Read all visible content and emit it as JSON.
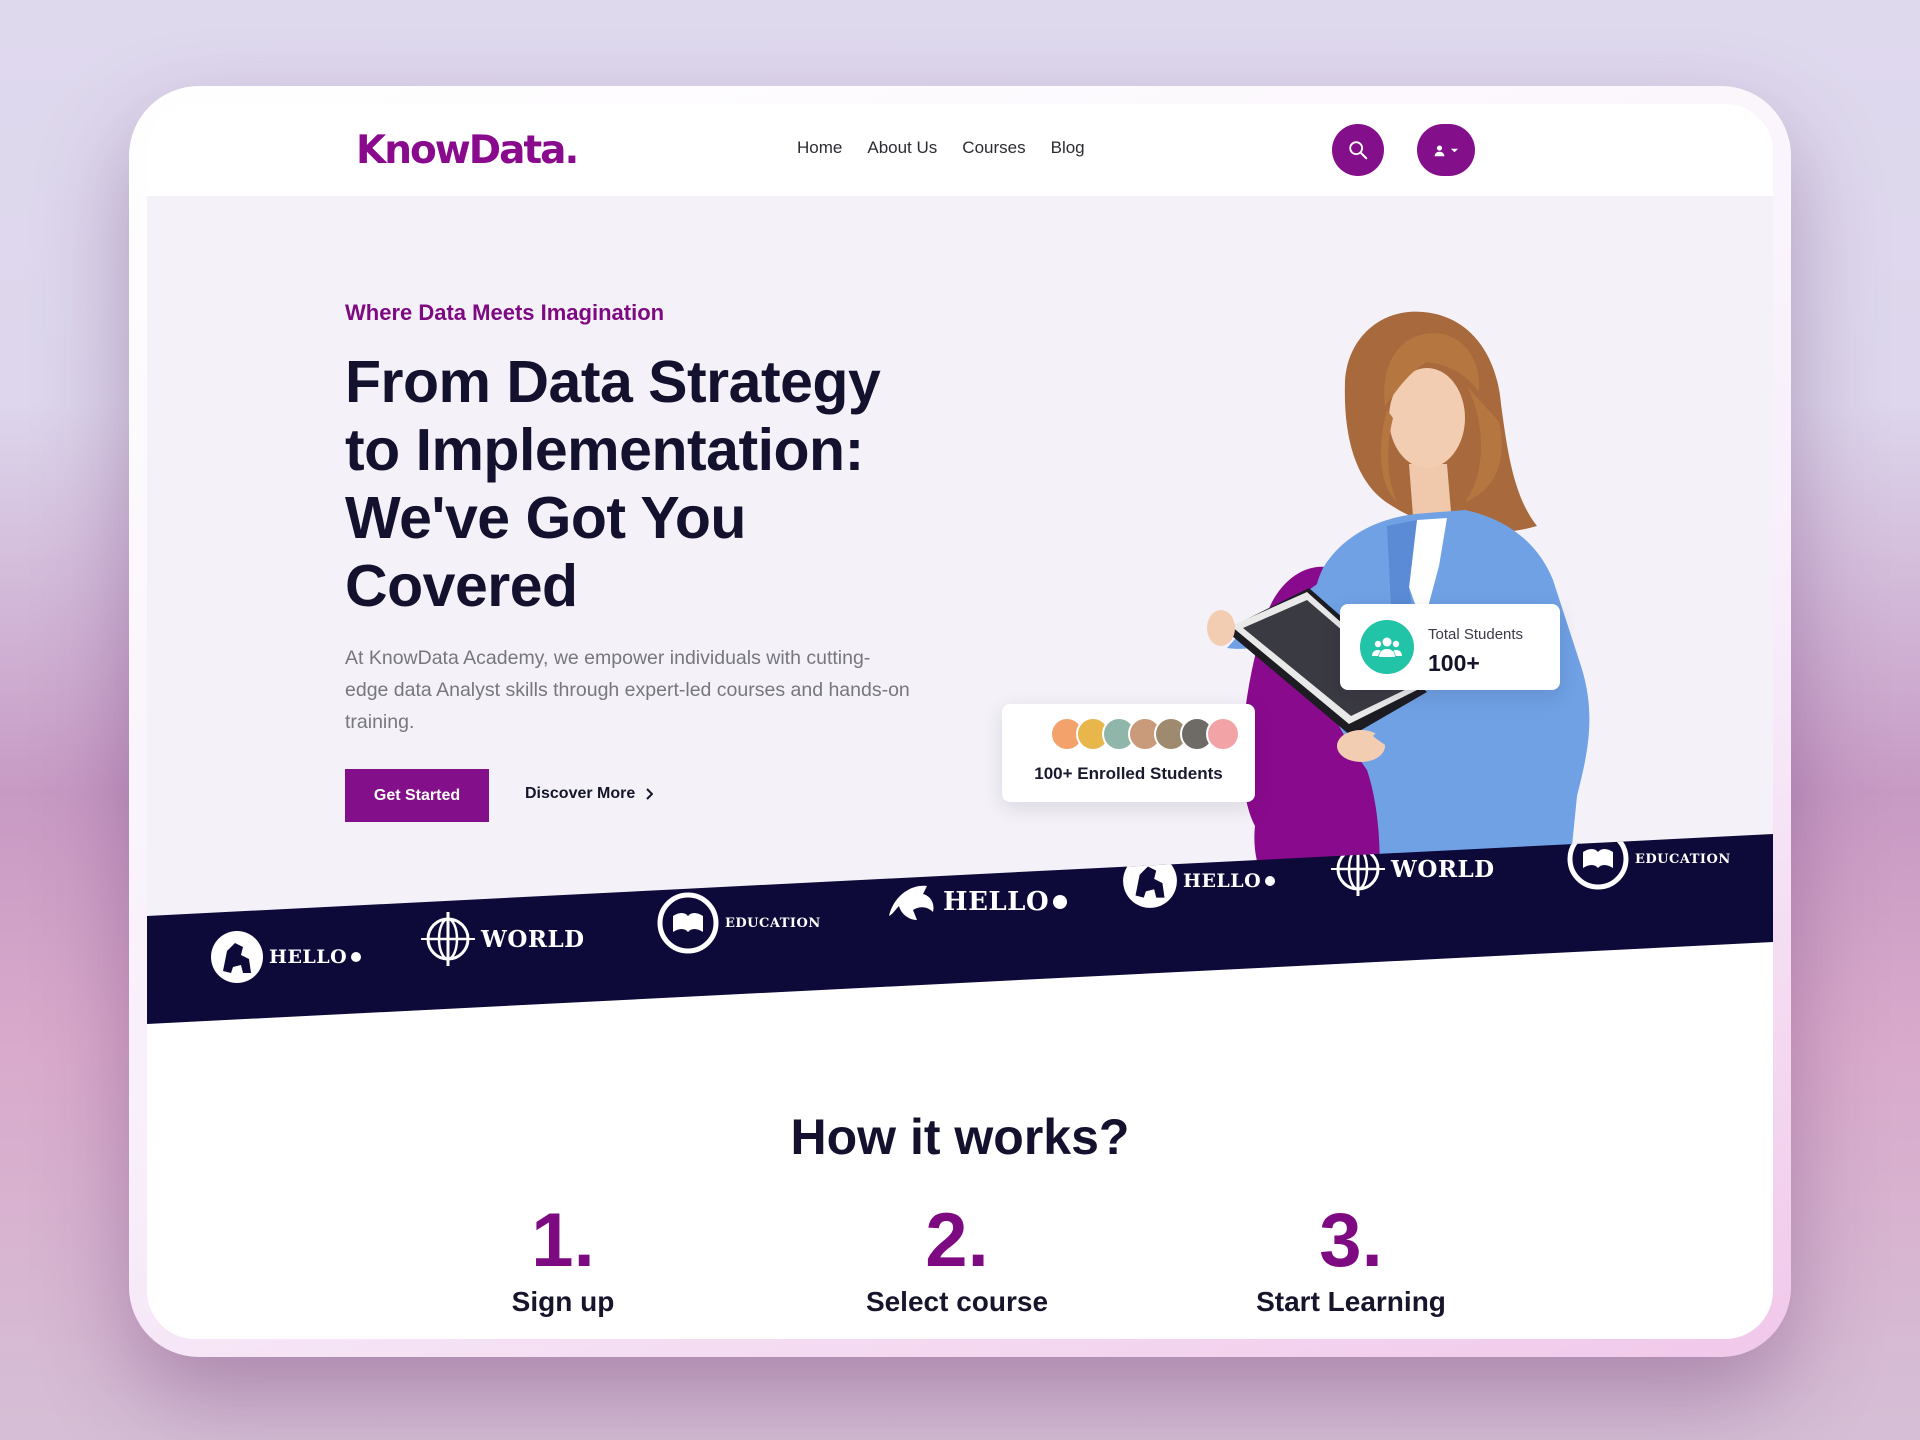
{
  "header": {
    "logo": "KnowData.",
    "nav": [
      "Home",
      "About Us",
      "Courses",
      "Blog"
    ]
  },
  "hero": {
    "eyebrow": "Where Data Meets Imagination",
    "headline_lines": [
      "From Data Strategy",
      "to Implementation:",
      "We've Got You",
      "Covered"
    ],
    "lead_lines": [
      "At KnowData Academy, we empower individuals with cutting-",
      "edge data Analyst skills through expert-led courses and hands-on",
      "training."
    ],
    "primary_cta": "Get Started",
    "secondary_cta": "Discover More"
  },
  "stats": {
    "total_label": "Total Students",
    "total_value": "100+",
    "enrolled_label": "100+ Enrolled Students"
  },
  "partners": [
    "HELLO",
    "WORLD",
    "EDUCATION",
    "HELLO",
    "HELLO",
    "WORLD",
    "EDUCATION"
  ],
  "how": {
    "title": "How it works?",
    "steps": [
      {
        "num": "1.",
        "label": "Sign up"
      },
      {
        "num": "2.",
        "label": "Select course"
      },
      {
        "num": "3.",
        "label": "Start Learning"
      }
    ]
  },
  "colors": {
    "brand_purple": "#840f8a",
    "navy": "#0d0938",
    "accent_teal": "#21c4a7"
  },
  "icons": [
    "search-icon",
    "user-icon",
    "chevron-down-icon",
    "chevron-right-icon",
    "users-icon"
  ]
}
